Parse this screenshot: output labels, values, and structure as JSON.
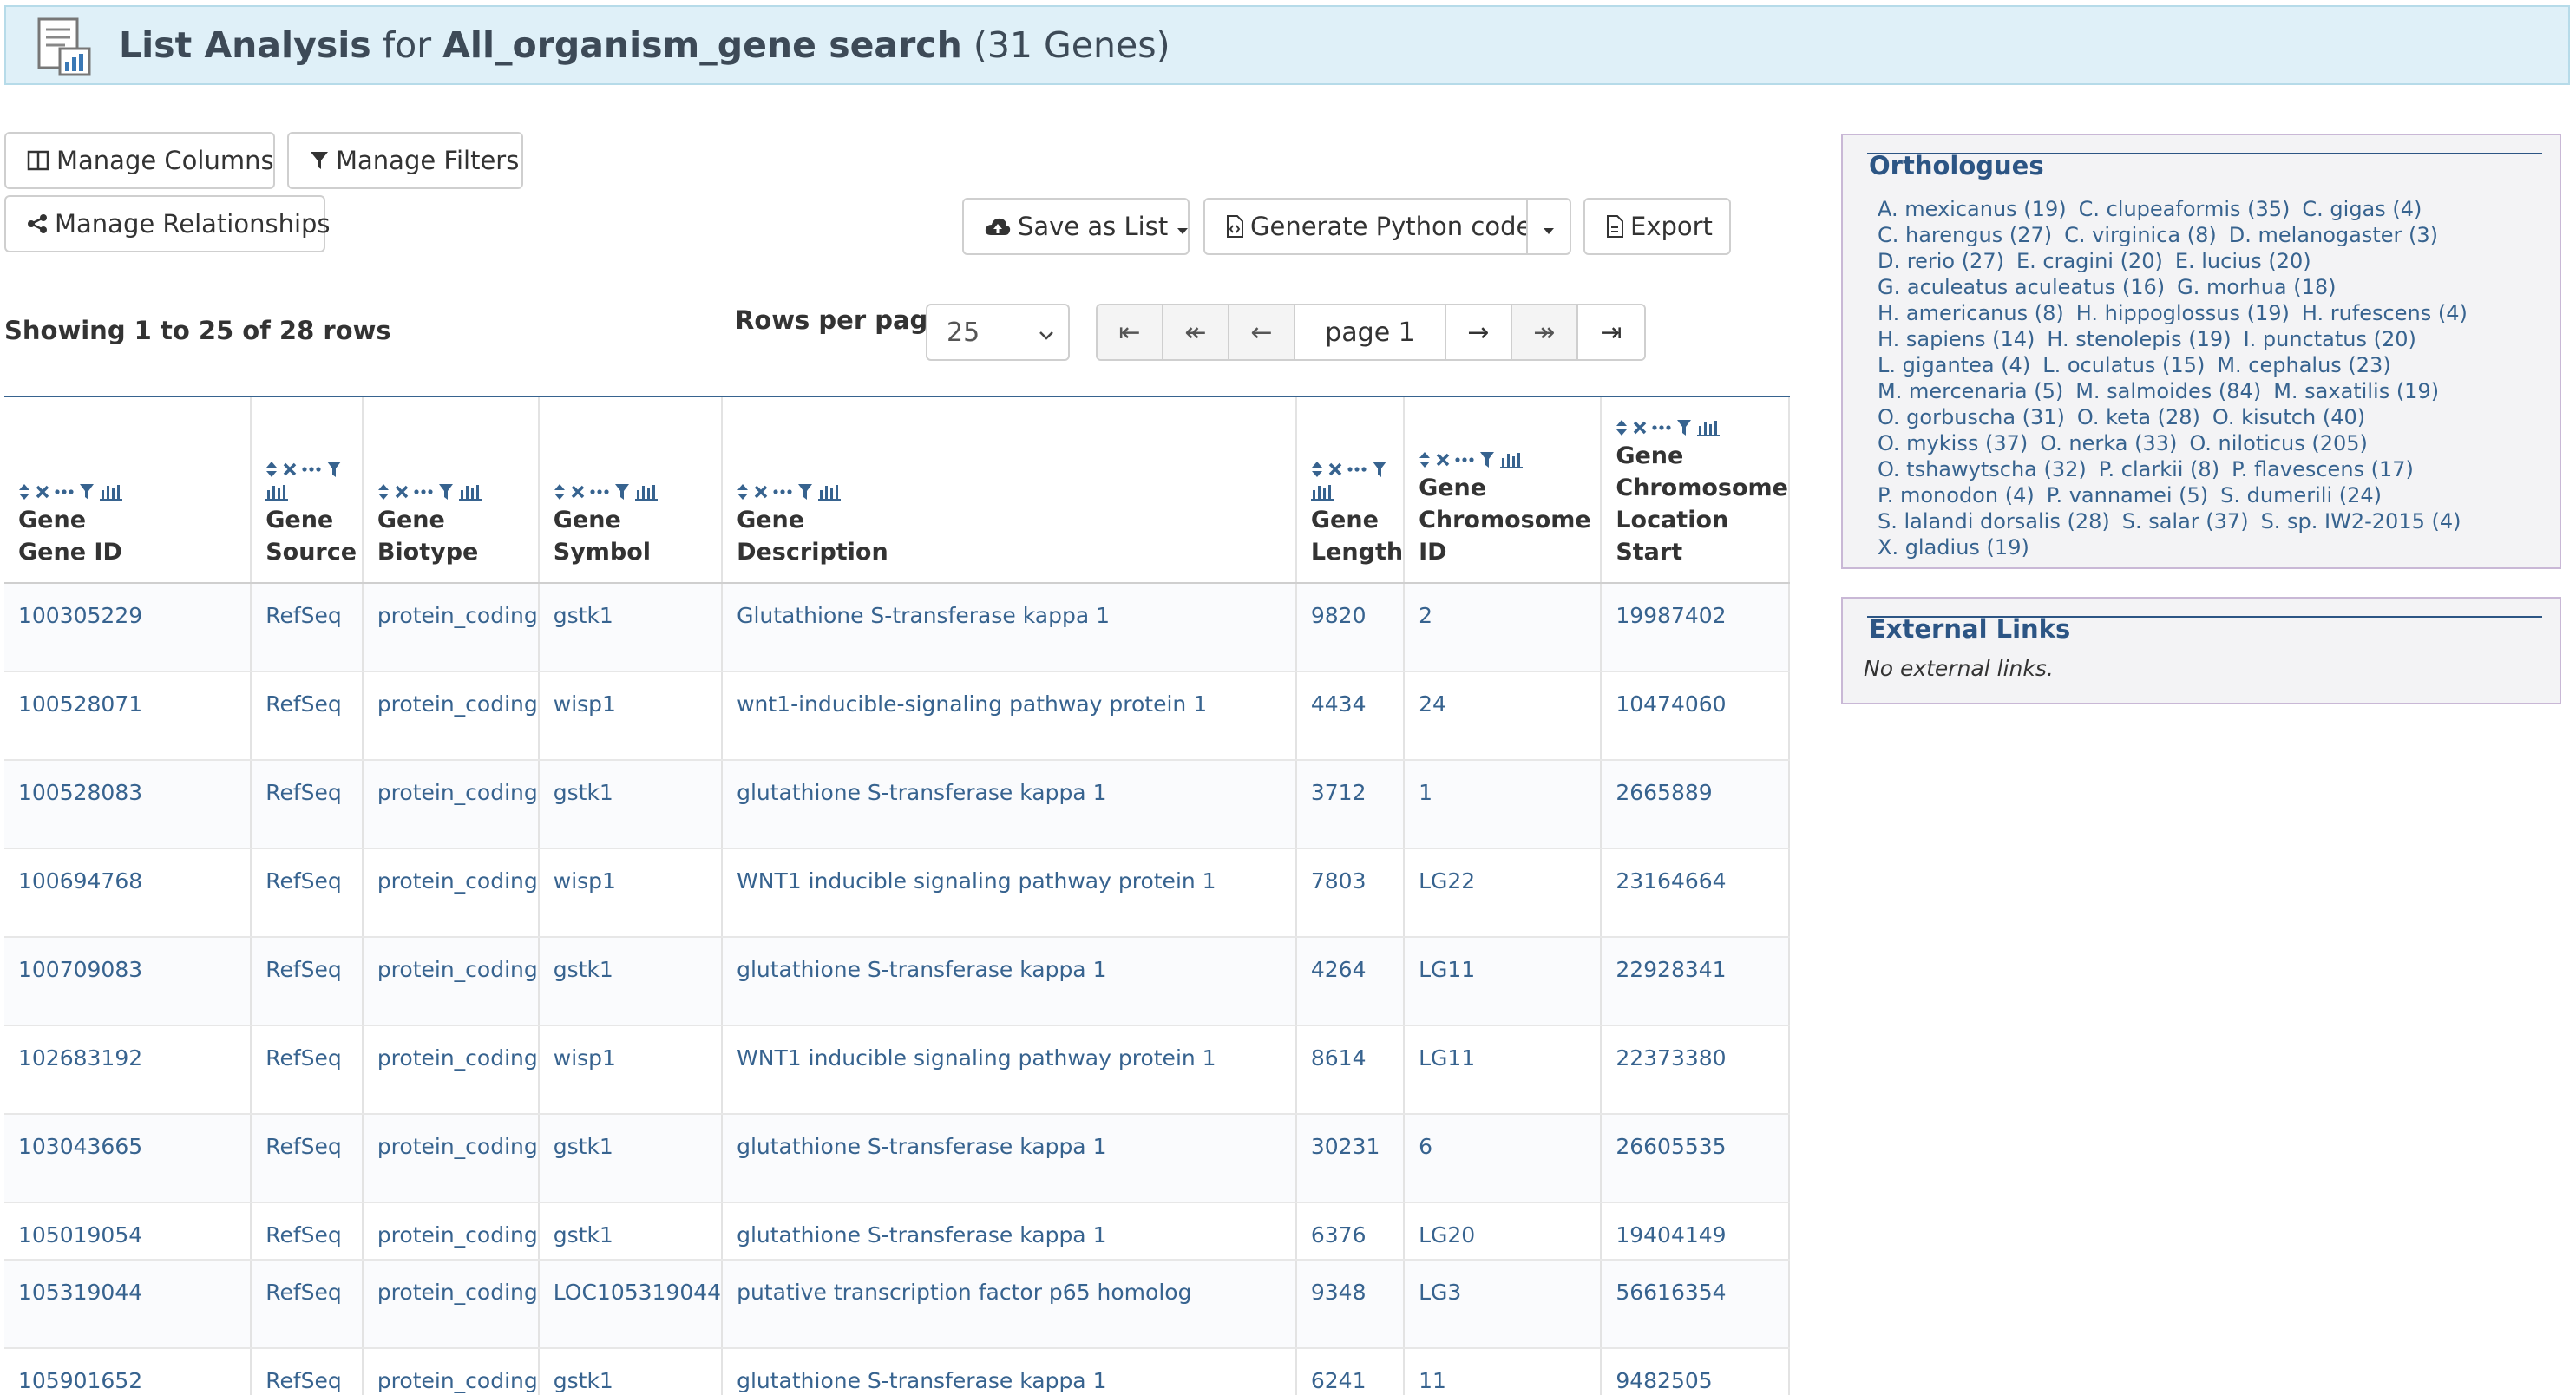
{
  "header": {
    "title_bold": "List Analysis",
    "title_for": "for",
    "title_search": "All_organism_gene search",
    "title_count": "(31 Genes)"
  },
  "toolbar": {
    "manage_columns": "Manage Columns",
    "manage_filters": "Manage Filters",
    "manage_relationships": "Manage Relationships",
    "save_as_list": "Save as List",
    "generate_python": "Generate Python code",
    "export": "Export"
  },
  "table_status": {
    "showing": "Showing 1 to 25 of 28 rows",
    "rows_per_page_label": "Rows per page:",
    "rows_per_page_value": "25",
    "page_label": "page 1"
  },
  "columns": [
    {
      "line1": "Gene",
      "line2": "Gene ID"
    },
    {
      "line1": "Gene",
      "line2": "Source"
    },
    {
      "line1": "Gene",
      "line2": "Biotype"
    },
    {
      "line1": "Gene",
      "line2": "Symbol"
    },
    {
      "line1": "Gene",
      "line2": "Description"
    },
    {
      "line1": "Gene",
      "line2": "Length"
    },
    {
      "line1": "Gene",
      "line2": "Chromosome",
      "line3": "ID"
    },
    {
      "line1": "Gene",
      "line2": "Chromosome",
      "line3": "Location",
      "line4": "Start"
    }
  ],
  "rows": [
    [
      "100305229",
      "RefSeq",
      "protein_coding",
      "gstk1",
      "Glutathione S-transferase kappa 1",
      "9820",
      "2",
      "19987402"
    ],
    [
      "100528071",
      "RefSeq",
      "protein_coding",
      "wisp1",
      "wnt1-inducible-signaling pathway protein 1",
      "4434",
      "24",
      "10474060"
    ],
    [
      "100528083",
      "RefSeq",
      "protein_coding",
      "gstk1",
      "glutathione S-transferase kappa 1",
      "3712",
      "1",
      "2665889"
    ],
    [
      "100694768",
      "RefSeq",
      "protein_coding",
      "wisp1",
      "WNT1 inducible signaling pathway protein 1",
      "7803",
      "LG22",
      "23164664"
    ],
    [
      "100709083",
      "RefSeq",
      "protein_coding",
      "gstk1",
      "glutathione S-transferase kappa 1",
      "4264",
      "LG11",
      "22928341"
    ],
    [
      "102683192",
      "RefSeq",
      "protein_coding",
      "wisp1",
      "WNT1 inducible signaling pathway protein 1",
      "8614",
      "LG11",
      "22373380"
    ],
    [
      "103043665",
      "RefSeq",
      "protein_coding",
      "gstk1",
      "glutathione S-transferase kappa 1",
      "30231",
      "6",
      "26605535"
    ],
    [
      "105019054",
      "RefSeq",
      "protein_coding",
      "gstk1",
      "glutathione S-transferase kappa 1",
      "6376",
      "LG20",
      "19404149"
    ],
    [
      "105319044",
      "RefSeq",
      "protein_coding",
      "LOC105319044",
      "putative transcription factor p65 homolog",
      "9348",
      "LG3",
      "56616354"
    ],
    [
      "105901652",
      "RefSeq",
      "protein_coding",
      "gstk1",
      "glutathione S-transferase kappa 1",
      "6241",
      "11",
      "9482505"
    ]
  ],
  "orthologues": {
    "title": "Orthologues",
    "items": [
      "A. mexicanus (19)",
      "C. clupeaformis (35)",
      "C. gigas (4)",
      "C. harengus (27)",
      "C. virginica (8)",
      "D. melanogaster (3)",
      "D. rerio (27)",
      "E. cragini (20)",
      "E. lucius (20)",
      "G. aculeatus aculeatus (16)",
      "G. morhua (18)",
      "H. americanus (8)",
      "H. hippoglossus (19)",
      "H. rufescens (4)",
      "H. sapiens (14)",
      "H. stenolepis (19)",
      "I. punctatus (20)",
      "L. gigantea (4)",
      "L. oculatus (15)",
      "M. cephalus (23)",
      "M. mercenaria (5)",
      "M. salmoides (84)",
      "M. saxatilis (19)",
      "O. gorbuscha (31)",
      "O. keta (28)",
      "O. kisutch (40)",
      "O. mykiss (37)",
      "O. nerka (33)",
      "O. niloticus (205)",
      "O. tshawytscha (32)",
      "P. clarkii (8)",
      "P. flavescens (17)",
      "P. monodon (4)",
      "P. vannamei (5)",
      "S. dumerili (24)",
      "S. lalandi dorsalis (28)",
      "S. salar (37)",
      "S. sp. IW2-2015 (4)",
      "X. gladius (19)"
    ]
  },
  "external_links": {
    "title": "External Links",
    "empty": "No external links."
  },
  "colors": {
    "link": "#37638f",
    "header_bg": "#dff0f8",
    "panel_title": "#2c5584"
  }
}
